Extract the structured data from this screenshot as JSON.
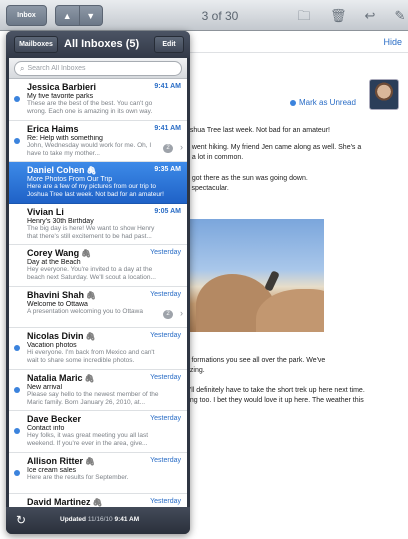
{
  "toolbar": {
    "inbox_button": "Inbox",
    "counter": "3 of 30",
    "icons": [
      "folder-icon",
      "trash-icon",
      "reply-icon",
      "compose-icon"
    ]
  },
  "message": {
    "hide_label": "Hide",
    "mark_unread_label": "Mark as Unread",
    "body_lines": [
      "oshua Tree last week. Not bad for an amateur!",
      "e went hiking. My friend Jen came along as well. She's a",
      "e a lot in common.",
      "e got there as the sun was going down.",
      "s spectacular.",
      "k formations you see all over the park. We've",
      "azing.",
      "e'll definitely have to take the short trek up here next time.",
      "ong too. I bet they would love it up here. The weather this"
    ]
  },
  "popover": {
    "mailboxes_button": "Mailboxes",
    "title": "All Inboxes (5)",
    "edit_button": "Edit",
    "search_placeholder": "Search All Inboxes",
    "messages": [
      {
        "from": "Jessica Barbieri",
        "time": "9:41 AM",
        "subject": "My five favorite parks",
        "preview": "These are the best of the best. You can't go wrong. Each one is amazing in its own way.",
        "unread": true,
        "attachment": false,
        "count": ""
      },
      {
        "from": "Erica Haims",
        "time": "9:41 AM",
        "subject": "Re: Help with something",
        "preview": "John, Wednesday would work for me. Oh, I have to take my mother...",
        "unread": true,
        "attachment": false,
        "count": "2"
      },
      {
        "from": "Daniel Cohen",
        "time": "9:35 AM",
        "subject": "More Photos From Our Trip",
        "preview": "Here are a few of my pictures from our trip to Joshua Tree last week. Not bad for an amateur!",
        "unread": false,
        "attachment": true,
        "count": ""
      },
      {
        "from": "Vivian Li",
        "time": "9:05 AM",
        "subject": "Henry's 30th Birthday",
        "preview": "The big day is here! We want to show Henry that there's still excitement to be had past...",
        "unread": false,
        "attachment": false,
        "count": ""
      },
      {
        "from": "Corey Wang",
        "time": "Yesterday",
        "subject": "Day at the Beach",
        "preview": "Hey everyone. You're invited to a day at the beach next Saturday. We'll scout a location...",
        "unread": false,
        "attachment": true,
        "count": ""
      },
      {
        "from": "Bhavini Shah",
        "time": "Yesterday",
        "subject": "Welcome to Ottawa",
        "preview": "A presentation welcoming you to Ottawa",
        "unread": false,
        "attachment": true,
        "count": "2"
      },
      {
        "from": "Nicolas Divin",
        "time": "Yesterday",
        "subject": "Vacation photos",
        "preview": "Hi everyone. I'm back from Mexico and can't wait to share some incredible photos.",
        "unread": true,
        "attachment": true,
        "count": ""
      },
      {
        "from": "Natalia Maric",
        "time": "Yesterday",
        "subject": "New arrival",
        "preview": "Please say hello to the newest member of the Maric family. Born January 26, 2010, at...",
        "unread": true,
        "attachment": true,
        "count": ""
      },
      {
        "from": "Dave Becker",
        "time": "Yesterday",
        "subject": "Contact info",
        "preview": "Hey folks, it was great meeting you all last weekend. If you're ever in the area, give...",
        "unread": true,
        "attachment": false,
        "count": ""
      },
      {
        "from": "Allison Ritter",
        "time": "Yesterday",
        "subject": "Ice cream sales",
        "preview": "Here are the results for September.",
        "unread": true,
        "attachment": true,
        "count": ""
      },
      {
        "from": "David Martinez",
        "time": "Yesterday",
        "subject": "",
        "preview": "",
        "unread": false,
        "attachment": true,
        "count": ""
      }
    ],
    "footer": {
      "prefix": "Updated",
      "date": "11/16/10",
      "time": "9:41 AM"
    }
  }
}
